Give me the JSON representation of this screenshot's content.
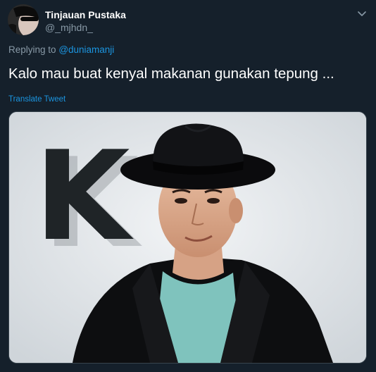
{
  "tweet": {
    "author": {
      "display_name": "Tinjauan Pustaka",
      "handle": "@_mjhdn_"
    },
    "reply": {
      "prefix": "Replying to",
      "mention": "@duniamanji"
    },
    "text": "Kalo mau buat kenyal makanan gunakan tepung ...",
    "translate_label": "Translate Tweet",
    "media": {
      "letter": "K",
      "alt": "Photo of a man in a black fedora hat, black blazer and teal t-shirt next to a large letter K"
    }
  },
  "colors": {
    "background": "#15202b",
    "secondary_text": "#8899a6",
    "link": "#1b95e0",
    "primary_text": "#ffffff"
  },
  "icons": {
    "caret": "chevron-down-icon",
    "avatar": "avatar"
  }
}
